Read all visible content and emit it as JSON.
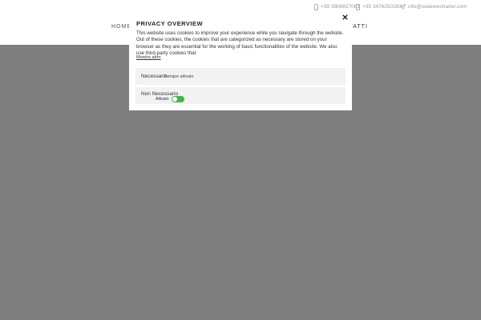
{
  "topbar": {
    "phone1": "+39 3806827061",
    "phone2": "+39 3476250283",
    "email": "info@sealovecharter.com",
    "icons": [
      "mobile-phone-icon",
      "mobile-phone-icon",
      "send-icon"
    ],
    "icon_color": "#9a9a9a"
  },
  "nav": {
    "home": "HOME",
    "contatti": "ONTATTI"
  },
  "modal": {
    "title": "PRIVACY OVERVIEW",
    "body": "This website uses cookies to improve your experience while you navigate through the website. Out of these cookies, the cookies that are categorized as necessary are stored on your browser as they are essential for the working of basic functionalities of the website. We also use third-party cookies that",
    "show_more": "Mostra altro",
    "close_icon": "close-icon",
    "sections": [
      {
        "label": "Necessario",
        "status": "Sempre attivato"
      },
      {
        "label": "Non Necessario",
        "toggle_label": "Attivato",
        "toggle_on": true
      }
    ],
    "toggle_color": "#4caf50"
  },
  "overlay_color": "#7f7f7f"
}
